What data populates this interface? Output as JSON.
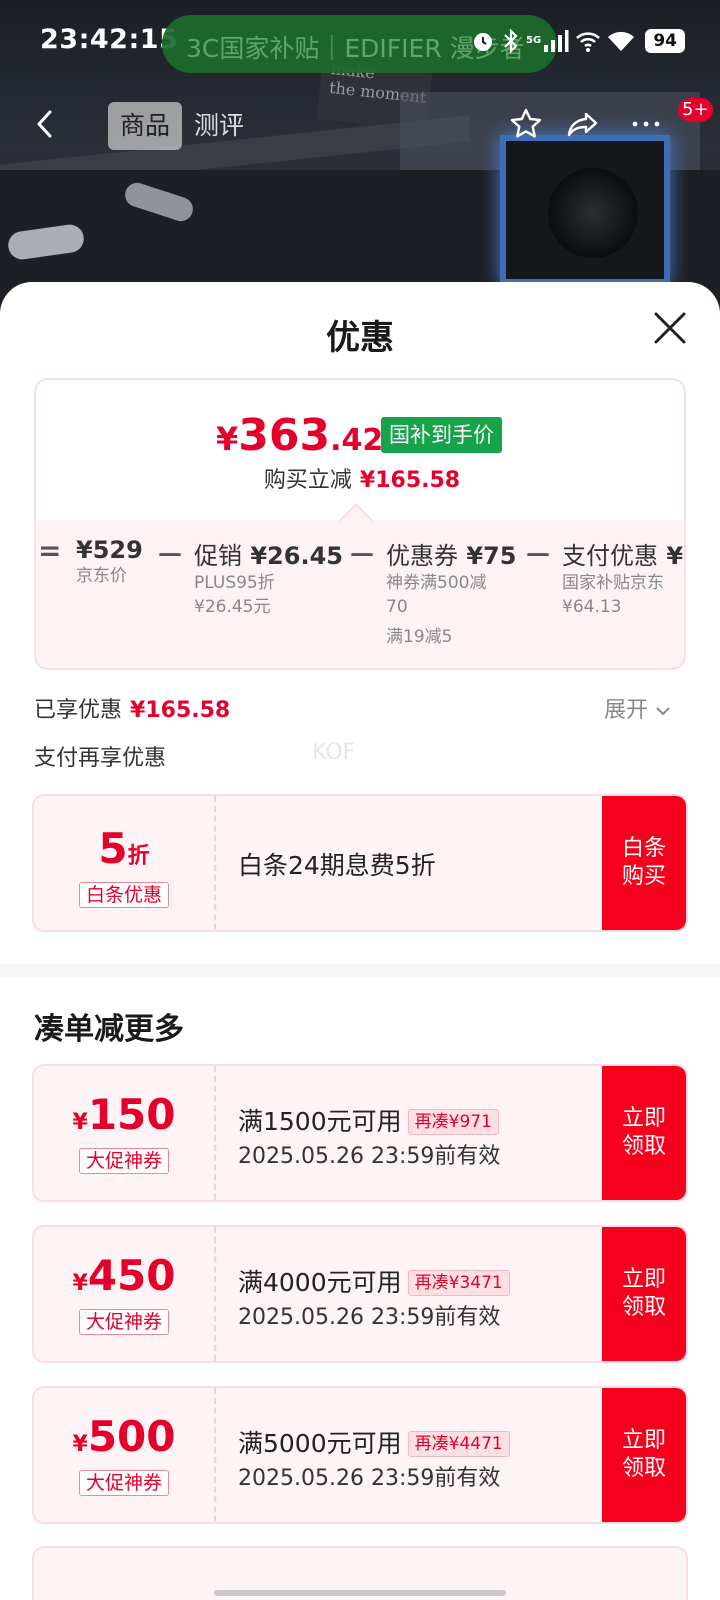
{
  "status_bar": {
    "time": "23:42:15",
    "pill_text": "3C国家补贴｜EDIFIER 漫步者",
    "network": "5G",
    "battery": "94"
  },
  "nav": {
    "tabs": [
      {
        "label": "商品",
        "active": true
      },
      {
        "label": "测评",
        "active": false
      }
    ],
    "badge": "5+"
  },
  "sheet": {
    "title": "优惠"
  },
  "price_summary": {
    "yen": "¥",
    "int": "363",
    "dec": ".42",
    "tag": "国补到手价",
    "reduce_label": "购买立减",
    "reduce_value": "¥165.58"
  },
  "breakdown": {
    "ops": [
      "=",
      "－",
      "－",
      "－"
    ],
    "items": [
      {
        "value": "¥529",
        "name": "",
        "subs": [
          "京东价"
        ]
      },
      {
        "value": "¥26.45",
        "name": "促销",
        "subs": [
          "PLUS95折",
          "¥26.45元"
        ]
      },
      {
        "value": "¥75",
        "name": "优惠券",
        "subs": [
          "神券满500减",
          "70",
          "满19减5"
        ]
      },
      {
        "value": "¥",
        "name": "支付优惠",
        "subs": [
          "国家补贴京东",
          "¥64.13"
        ]
      }
    ]
  },
  "enjoyed": {
    "label": "已享优惠",
    "value": "¥165.58",
    "expand": "展开"
  },
  "pay_more": {
    "label": "支付再享优惠",
    "watermark": "KOF"
  },
  "pay_coupon": {
    "amount": "5",
    "unit": "折",
    "tag": "白条优惠",
    "desc": "白条24期息费5折",
    "button": "白条购买"
  },
  "more_section": {
    "title": "凑单减更多"
  },
  "coupons": [
    {
      "yen": "¥",
      "amount": "150",
      "tag": "大促神券",
      "condition": "满1500元可用",
      "more": "再凑¥971",
      "valid": "2025.05.26 23:59前有效",
      "button": "立即领取"
    },
    {
      "yen": "¥",
      "amount": "450",
      "tag": "大促神券",
      "condition": "满4000元可用",
      "more": "再凑¥3471",
      "valid": "2025.05.26 23:59前有效",
      "button": "立即领取"
    },
    {
      "yen": "¥",
      "amount": "500",
      "tag": "大促神券",
      "condition": "满5000元可用",
      "more": "再凑¥4471",
      "valid": "2025.05.26 23:59前有效",
      "button": "立即领取"
    }
  ],
  "colors": {
    "accent_red": "#e4002b",
    "button_red": "#f6001e",
    "tag_green": "#16a34a"
  }
}
